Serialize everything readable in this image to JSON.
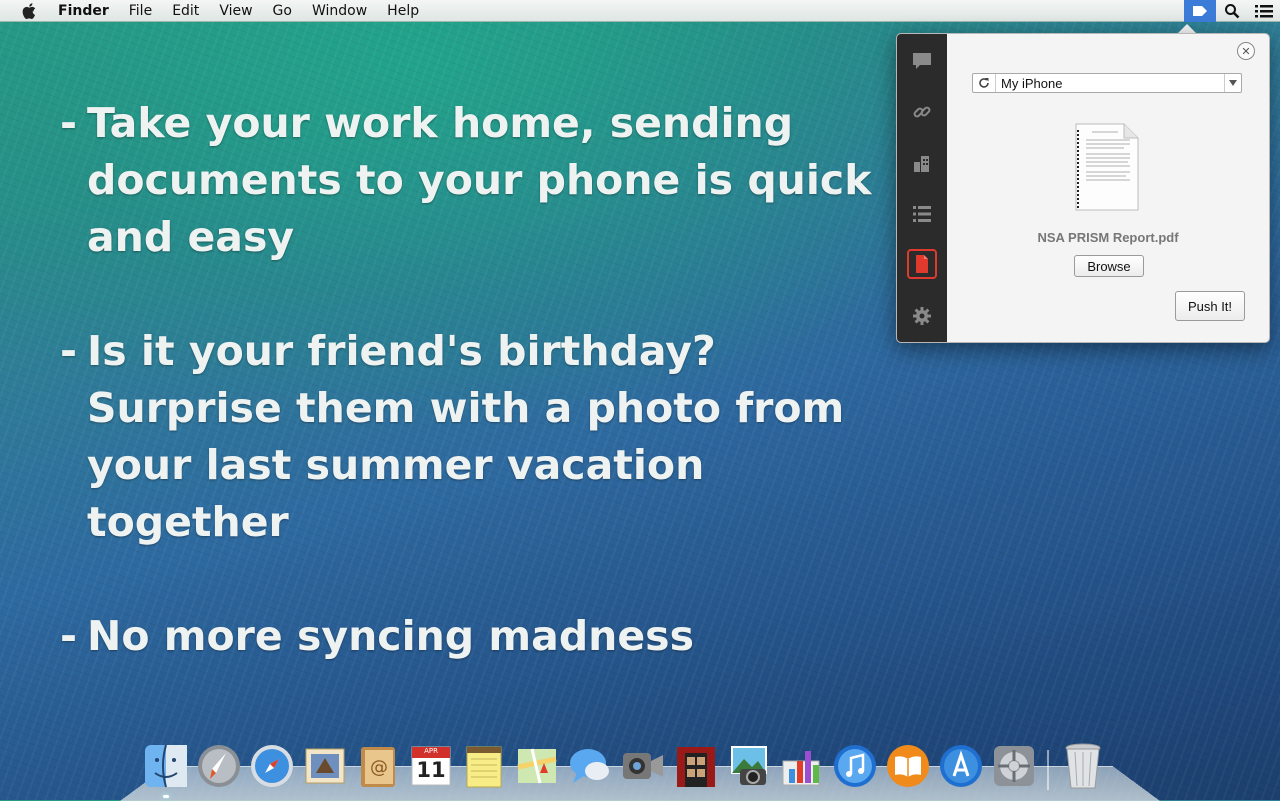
{
  "menubar": {
    "app_name": "Finder",
    "menus": [
      "File",
      "Edit",
      "View",
      "Go",
      "Window",
      "Help"
    ],
    "status_icons": [
      "pushbullet-icon",
      "spotlight-search-icon",
      "notification-center-icon"
    ]
  },
  "slide": {
    "bullets": [
      {
        "dash": "-",
        "text": "Take your work home, sending documents to your phone is quick and easy"
      },
      {
        "dash": "-",
        "text": "Is it your friend's birthday? Surprise them with a photo from your last summer vacation together"
      },
      {
        "dash": "-",
        "text": "No more syncing madness"
      }
    ]
  },
  "popover": {
    "sidebar_items": [
      {
        "name": "note-icon",
        "active": false
      },
      {
        "name": "link-icon",
        "active": false
      },
      {
        "name": "address-icon",
        "active": false
      },
      {
        "name": "list-icon",
        "active": false
      },
      {
        "name": "file-icon",
        "active": true
      },
      {
        "name": "settings-gear-icon",
        "active": false
      }
    ],
    "device_select": {
      "value": "My iPhone"
    },
    "file_name": "NSA PRISM Report.pdf",
    "browse_label": "Browse",
    "push_label": "Push It!"
  },
  "dock": {
    "apps": [
      "Finder",
      "Launchpad",
      "Safari",
      "Mail",
      "Contacts",
      "Calendar",
      "Notes",
      "Maps",
      "Messages",
      "FaceTime",
      "Photo Booth",
      "iPhoto",
      "Keynote",
      "iTunes",
      "iBooks",
      "App Store",
      "System Preferences"
    ],
    "calendar": {
      "month": "APR",
      "day": "11"
    },
    "trash": "Trash"
  },
  "colors": {
    "accent": "#3c7cd9",
    "active_border": "#e03a2e",
    "sidebar_bg": "#2b2b2b"
  }
}
